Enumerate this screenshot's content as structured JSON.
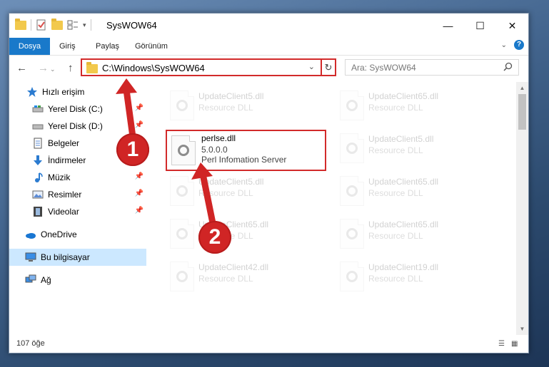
{
  "window": {
    "title": "SysWOW64",
    "controls": {
      "minimize": "—",
      "maximize": "☐",
      "close": "✕"
    }
  },
  "ribbon": {
    "tabs": [
      "Dosya",
      "Giriş",
      "Paylaş",
      "Görünüm"
    ],
    "help": "?",
    "collapse": "⌄"
  },
  "nav": {
    "back": "←",
    "forward": "→",
    "up": "↑"
  },
  "address": {
    "path": "C:\\Windows\\SysWOW64",
    "dropdown": "⌄",
    "refresh": "↻"
  },
  "search": {
    "placeholder": "Ara: SysWOW64",
    "icon": "search-icon"
  },
  "sidebar": {
    "items": [
      {
        "label": "Hızlı erişim",
        "icon": "star-icon",
        "pinned": false
      },
      {
        "label": "Yerel Disk (C:)",
        "icon": "drive-icon",
        "pinned": true
      },
      {
        "label": "Yerel Disk (D:)",
        "icon": "drive-icon",
        "pinned": true
      },
      {
        "label": "Belgeler",
        "icon": "documents-icon",
        "pinned": true
      },
      {
        "label": "İndirmeler",
        "icon": "download-icon",
        "pinned": true
      },
      {
        "label": "Müzik",
        "icon": "music-icon",
        "pinned": true
      },
      {
        "label": "Resimler",
        "icon": "pictures-icon",
        "pinned": true
      },
      {
        "label": "Videolar",
        "icon": "videos-icon",
        "pinned": true
      },
      {
        "label": "OneDrive",
        "icon": "cloud-icon",
        "pinned": false
      },
      {
        "label": "Bu bilgisayar",
        "icon": "computer-icon",
        "pinned": false,
        "selected": true
      },
      {
        "label": "Ağ",
        "icon": "network-icon",
        "pinned": false
      }
    ]
  },
  "files": {
    "highlighted": {
      "name": "perlse.dll",
      "version": "5.0.0.0",
      "description": "Perl Infomation Server"
    },
    "background": [
      {
        "name": "UpdateClient5.dll",
        "type": "Resource DLL"
      },
      {
        "name": "UpdateClient65.dll",
        "type": "Resource DLL"
      },
      {
        "name": "UpdateClient5.dll",
        "type": "Resource DLL"
      },
      {
        "name": "UpdateClient65.dll",
        "type": "Resource DLL"
      },
      {
        "name": "UpdateClient65.dll",
        "type": "Resource DLL"
      },
      {
        "name": "UpdateClient65.dll",
        "type": "Resource DLL"
      },
      {
        "name": "UpdateClient65.dll",
        "type": "Resource DLL"
      },
      {
        "name": "UpdateClient42.dll",
        "type": "Resource DLL"
      },
      {
        "name": "UpdateClient19.dll",
        "type": "Resource DLL"
      }
    ]
  },
  "status": {
    "count": "107 öğe"
  },
  "annotations": {
    "step1": "1",
    "step2": "2",
    "color": "#d02525"
  }
}
